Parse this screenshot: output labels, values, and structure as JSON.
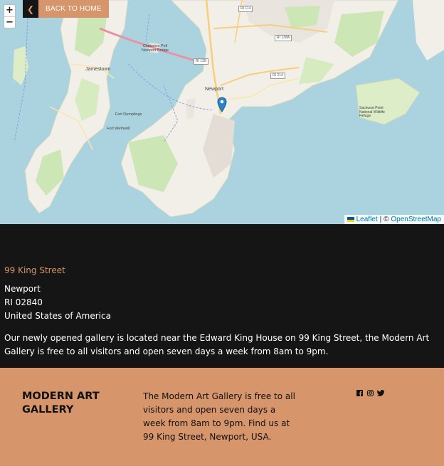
{
  "map": {
    "back_label": "BACK TO HOME",
    "zoom_in": "+",
    "zoom_out": "−",
    "attribution": {
      "leaflet": "Leaflet",
      "separator": "| ©",
      "osm": "OpenStreetMap"
    },
    "labels": {
      "jamestown": "Jamestown",
      "newport": "Newport",
      "bridge": "Claiborne Pell Newport Bridge",
      "dumplings": "Fort Dumplings",
      "wetherill": "Fort Wetherill",
      "sachuest": "Sachuest Point National Wildlife Refuge"
    },
    "shields": {
      "ri114": "RI 114",
      "ri138a": "RI 138A",
      "ri138": "RI 138",
      "ri214": "RI 214"
    }
  },
  "address": {
    "street": "99 King Street",
    "city": "Newport",
    "state_zip": "RI 02840",
    "country": "United States of America",
    "description": "Our newly opened gallery is located near the Edward King House on 99 King Street, the Modern Art Gallery is free to all visitors and open seven days a week from 8am to 9pm."
  },
  "footer": {
    "brand": "MODERN ART GALLERY",
    "text": "The Modern Art Gallery is free to all visitors and open seven days a week from 8am to 9pm. Find us at 99 King Street, Newport, USA.",
    "social": [
      "facebook-icon",
      "instagram-icon",
      "twitter-icon"
    ]
  },
  "colors": {
    "accent": "#d6956a",
    "dark": "#151515",
    "water": "#aad3df"
  }
}
